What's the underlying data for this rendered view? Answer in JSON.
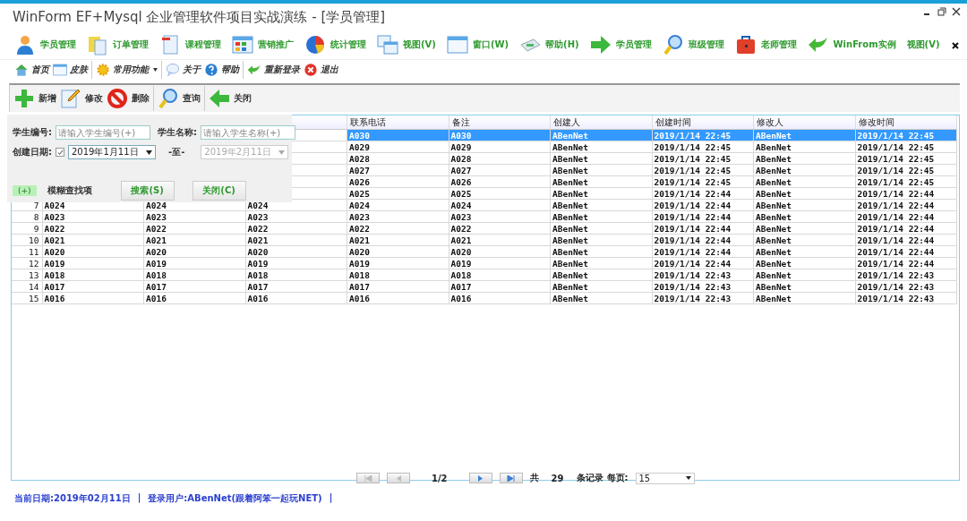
{
  "window": {
    "title": "WinForm EF+Mysql 企业管理软件项目实战演练 - [学员管理]"
  },
  "main_toolbar": {
    "items": [
      {
        "label": "学员管理",
        "kind": "icon"
      },
      {
        "label": "订单管理",
        "kind": "icon"
      },
      {
        "label": "课程管理",
        "kind": "icon"
      },
      {
        "label": "营销推广",
        "kind": "icon"
      },
      {
        "label": "统计管理",
        "kind": "icon"
      },
      {
        "label": "视图(V)",
        "kind": "icon"
      },
      {
        "label": "窗口(W)",
        "kind": "icon"
      },
      {
        "label": "帮助(H)",
        "kind": "icon"
      },
      {
        "label": "学员管理",
        "kind": "icon"
      },
      {
        "label": "班级管理",
        "kind": "icon"
      },
      {
        "label": "老师管理",
        "kind": "icon"
      },
      {
        "label": "WinFrom实例",
        "kind": "icon"
      },
      {
        "label": "视图(V)",
        "kind": "text"
      }
    ]
  },
  "quick_toolbar": {
    "items": [
      {
        "label": "首页",
        "dropdown": false,
        "separator_after": false
      },
      {
        "label": "皮肤",
        "dropdown": false,
        "separator_after": true
      },
      {
        "label": "常用功能",
        "dropdown": true,
        "separator_after": true
      },
      {
        "label": "关于",
        "dropdown": false,
        "separator_after": false
      },
      {
        "label": "帮助",
        "dropdown": false,
        "separator_after": true
      },
      {
        "label": "重新登录",
        "dropdown": false,
        "separator_after": false
      },
      {
        "label": "退出",
        "dropdown": false,
        "separator_after": false
      }
    ]
  },
  "action_toolbar": {
    "items": [
      {
        "label": "新增",
        "separator_after": false
      },
      {
        "label": "修改",
        "separator_after": false
      },
      {
        "label": "删除",
        "separator_after": true
      },
      {
        "label": "查询",
        "separator_after": true
      },
      {
        "label": "关闭",
        "separator_after": false
      }
    ]
  },
  "search_panel": {
    "student_id_label": "学生编号:",
    "student_id_placeholder": "请输入学生编号(+)",
    "student_name_label": "学生名称:",
    "student_name_placeholder": "请输入学生名称(+)",
    "date_label": "创建日期:",
    "date_enabled": true,
    "date_from": "2019年1月11日",
    "date_to_label": "-至-",
    "date_to": "2019年2月11日",
    "legend_mark": "(+)",
    "legend_text": "模糊查找项",
    "search_button": "搜索(S)",
    "close_button": "关闭(C)"
  },
  "table": {
    "columns": [
      "联系电话",
      "备注",
      "创建人",
      "创建时间",
      "修改人",
      "修改时间"
    ],
    "rows": [
      {
        "selected": true,
        "cells": [
          "A030",
          "A030",
          "ABenNet",
          "2019/1/14 22:45",
          "ABenNet",
          "2019/1/14 22:45"
        ]
      },
      {
        "selected": false,
        "cells": [
          "A029",
          "A029",
          "ABenNet",
          "2019/1/14 22:45",
          "ABenNet",
          "2019/1/14 22:45"
        ]
      },
      {
        "selected": false,
        "cells": [
          "A028",
          "A028",
          "ABenNet",
          "2019/1/14 22:45",
          "ABenNet",
          "2019/1/14 22:45"
        ]
      },
      {
        "selected": false,
        "cells": [
          "A027",
          "A027",
          "ABenNet",
          "2019/1/14 22:45",
          "ABenNet",
          "2019/1/14 22:45"
        ]
      },
      {
        "selected": false,
        "cells": [
          "A026",
          "A026",
          "ABenNet",
          "2019/1/14 22:45",
          "ABenNet",
          "2019/1/14 22:45"
        ]
      },
      {
        "selected": false,
        "cells": [
          "A025",
          "A025",
          "ABenNet",
          "2019/1/14 22:44",
          "ABenNet",
          "2019/1/14 22:44"
        ]
      },
      {
        "number": "7",
        "selected": false,
        "cells": [
          "A024",
          "A024",
          "A024",
          "A024",
          "A024",
          "ABenNet",
          "2019/1/14 22:44",
          "ABenNet",
          "2019/1/14 22:44"
        ]
      },
      {
        "number": "8",
        "selected": false,
        "cells": [
          "A023",
          "A023",
          "A023",
          "A023",
          "A023",
          "ABenNet",
          "2019/1/14 22:44",
          "ABenNet",
          "2019/1/14 22:44"
        ]
      },
      {
        "number": "9",
        "selected": false,
        "cells": [
          "A022",
          "A022",
          "A022",
          "A022",
          "A022",
          "ABenNet",
          "2019/1/14 22:44",
          "ABenNet",
          "2019/1/14 22:44"
        ]
      },
      {
        "number": "10",
        "selected": false,
        "cells": [
          "A021",
          "A021",
          "A021",
          "A021",
          "A021",
          "ABenNet",
          "2019/1/14 22:44",
          "ABenNet",
          "2019/1/14 22:44"
        ]
      },
      {
        "number": "11",
        "selected": false,
        "cells": [
          "A020",
          "A020",
          "A020",
          "A020",
          "A020",
          "ABenNet",
          "2019/1/14 22:44",
          "ABenNet",
          "2019/1/14 22:44"
        ]
      },
      {
        "number": "12",
        "selected": false,
        "cells": [
          "A019",
          "A019",
          "A019",
          "A019",
          "A019",
          "ABenNet",
          "2019/1/14 22:44",
          "ABenNet",
          "2019/1/14 22:44"
        ]
      },
      {
        "number": "13",
        "selected": false,
        "cells": [
          "A018",
          "A018",
          "A018",
          "A018",
          "A018",
          "ABenNet",
          "2019/1/14 22:43",
          "ABenNet",
          "2019/1/14 22:43"
        ]
      },
      {
        "number": "14",
        "selected": false,
        "cells": [
          "A017",
          "A017",
          "A017",
          "A017",
          "A017",
          "ABenNet",
          "2019/1/14 22:43",
          "ABenNet",
          "2019/1/14 22:43"
        ]
      },
      {
        "number": "15",
        "selected": false,
        "cells": [
          "A016",
          "A016",
          "A016",
          "A016",
          "A016",
          "ABenNet",
          "2019/1/14 22:43",
          "ABenNet",
          "2019/1/14 22:43"
        ]
      }
    ]
  },
  "pager": {
    "page": "1/2",
    "total_prefix": "共",
    "total": "29",
    "total_suffix": "条记录",
    "per_page_label": "每页:",
    "per_page": "15",
    "first_enabled": false,
    "prev_enabled": false,
    "next_enabled": true,
    "last_enabled": true
  },
  "status_bar": {
    "items": [
      "当前日期:2019年02月11日",
      "|",
      "登录用户:ABenNet(跟着阿笨一起玩NET)",
      "|"
    ]
  }
}
